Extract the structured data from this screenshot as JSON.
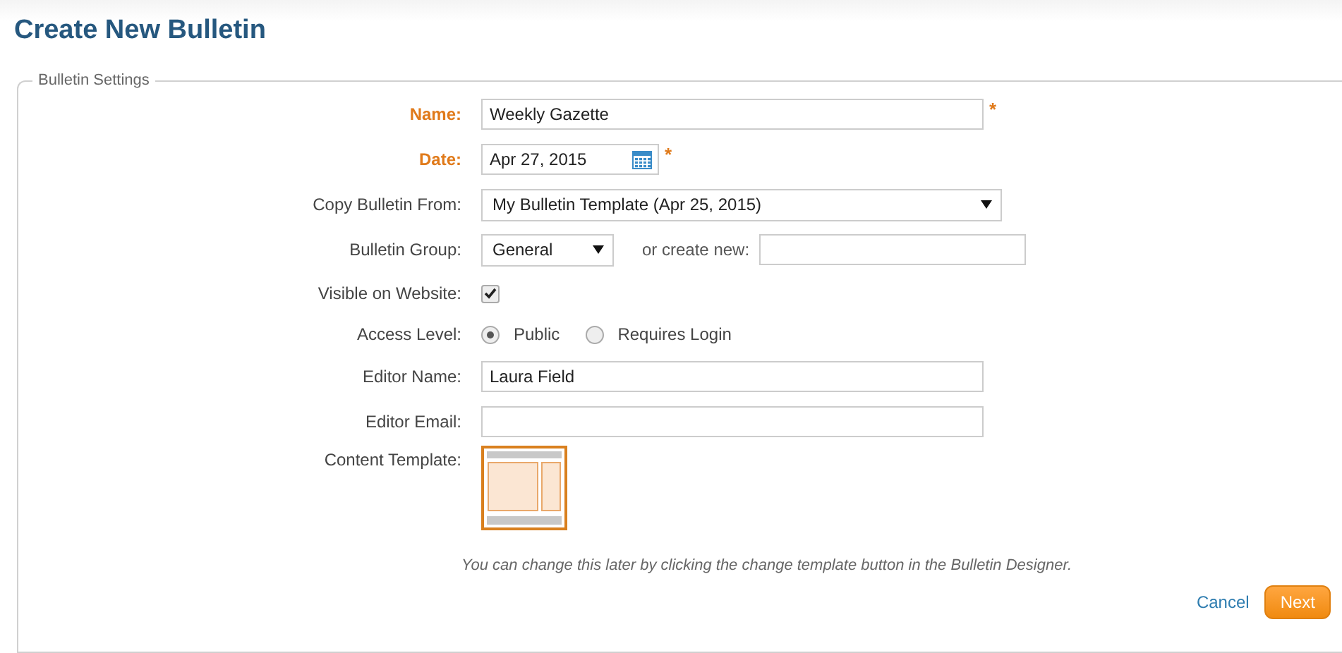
{
  "page_title": "Create New Bulletin",
  "section": {
    "legend": "Bulletin Settings"
  },
  "required_mark": "*",
  "fields": [
    {
      "kind": "text",
      "label": "Name:",
      "required": true,
      "value": "Weekly Gazette"
    },
    {
      "kind": "date",
      "label": "Date:",
      "required": true,
      "value": "Apr 27, 2015"
    },
    {
      "kind": "select",
      "label": "Copy Bulletin From:",
      "required": false,
      "value": "My Bulletin Template (Apr 25, 2015)"
    },
    {
      "kind": "group",
      "label": "Bulletin Group:",
      "required": false,
      "value": "General",
      "create_label": "or create new:"
    },
    {
      "kind": "checkbox",
      "label": "Visible on Website:",
      "required": false,
      "checked": true
    },
    {
      "kind": "radio",
      "label": "Access Level:",
      "required": false,
      "options": [
        {
          "label": "Public",
          "selected": true
        },
        {
          "label": "Requires Login",
          "selected": false
        }
      ]
    },
    {
      "kind": "text",
      "label": "Editor Name:",
      "required": false,
      "value": "Laura Field"
    },
    {
      "kind": "text",
      "label": "Editor Email:",
      "required": false
    },
    {
      "kind": "template",
      "label": "Content Template:",
      "required": false,
      "selected": true
    }
  ],
  "hint": "You can change this later by clicking the change template button in the Bulletin Designer.",
  "buttons": {
    "cancel": "Cancel",
    "next": "Next"
  }
}
